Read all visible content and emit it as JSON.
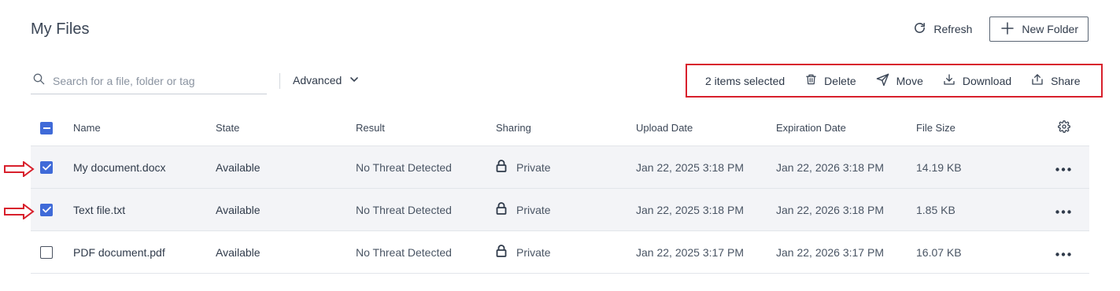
{
  "header": {
    "title": "My Files",
    "refresh_label": "Refresh",
    "new_folder_label": "New Folder"
  },
  "search": {
    "placeholder": "Search for a file, folder or tag",
    "value": ""
  },
  "filter": {
    "advanced_label": "Advanced"
  },
  "selection": {
    "count_label": "2 items selected",
    "actions": [
      {
        "label": "Delete",
        "icon": "trash-icon"
      },
      {
        "label": "Move",
        "icon": "send-icon"
      },
      {
        "label": "Download",
        "icon": "download-icon"
      },
      {
        "label": "Share",
        "icon": "share-icon"
      }
    ]
  },
  "table": {
    "columns": [
      "Name",
      "State",
      "Result",
      "Sharing",
      "Upload Date",
      "Expiration Date",
      "File Size"
    ],
    "select_all_state": "partial",
    "rows": [
      {
        "checked": true,
        "name": "My document.docx",
        "state": "Available",
        "result": "No Threat Detected",
        "sharing": "Private",
        "upload": "Jan 22, 2025 3:18 PM",
        "expiration": "Jan 22, 2026 3:18 PM",
        "size": "14.19 KB"
      },
      {
        "checked": true,
        "name": "Text file.txt",
        "state": "Available",
        "result": "No Threat Detected",
        "sharing": "Private",
        "upload": "Jan 22, 2025 3:18 PM",
        "expiration": "Jan 22, 2026 3:18 PM",
        "size": "1.85 KB"
      },
      {
        "checked": false,
        "name": "PDF document.pdf",
        "state": "Available",
        "result": "No Threat Detected",
        "sharing": "Private",
        "upload": "Jan 22, 2025 3:17 PM",
        "expiration": "Jan 22, 2026 3:17 PM",
        "size": "16.07 KB"
      }
    ]
  },
  "colors": {
    "accent": "#3f6ad8",
    "annotation": "#d8202c",
    "selected_row": "#f3f4f7"
  }
}
